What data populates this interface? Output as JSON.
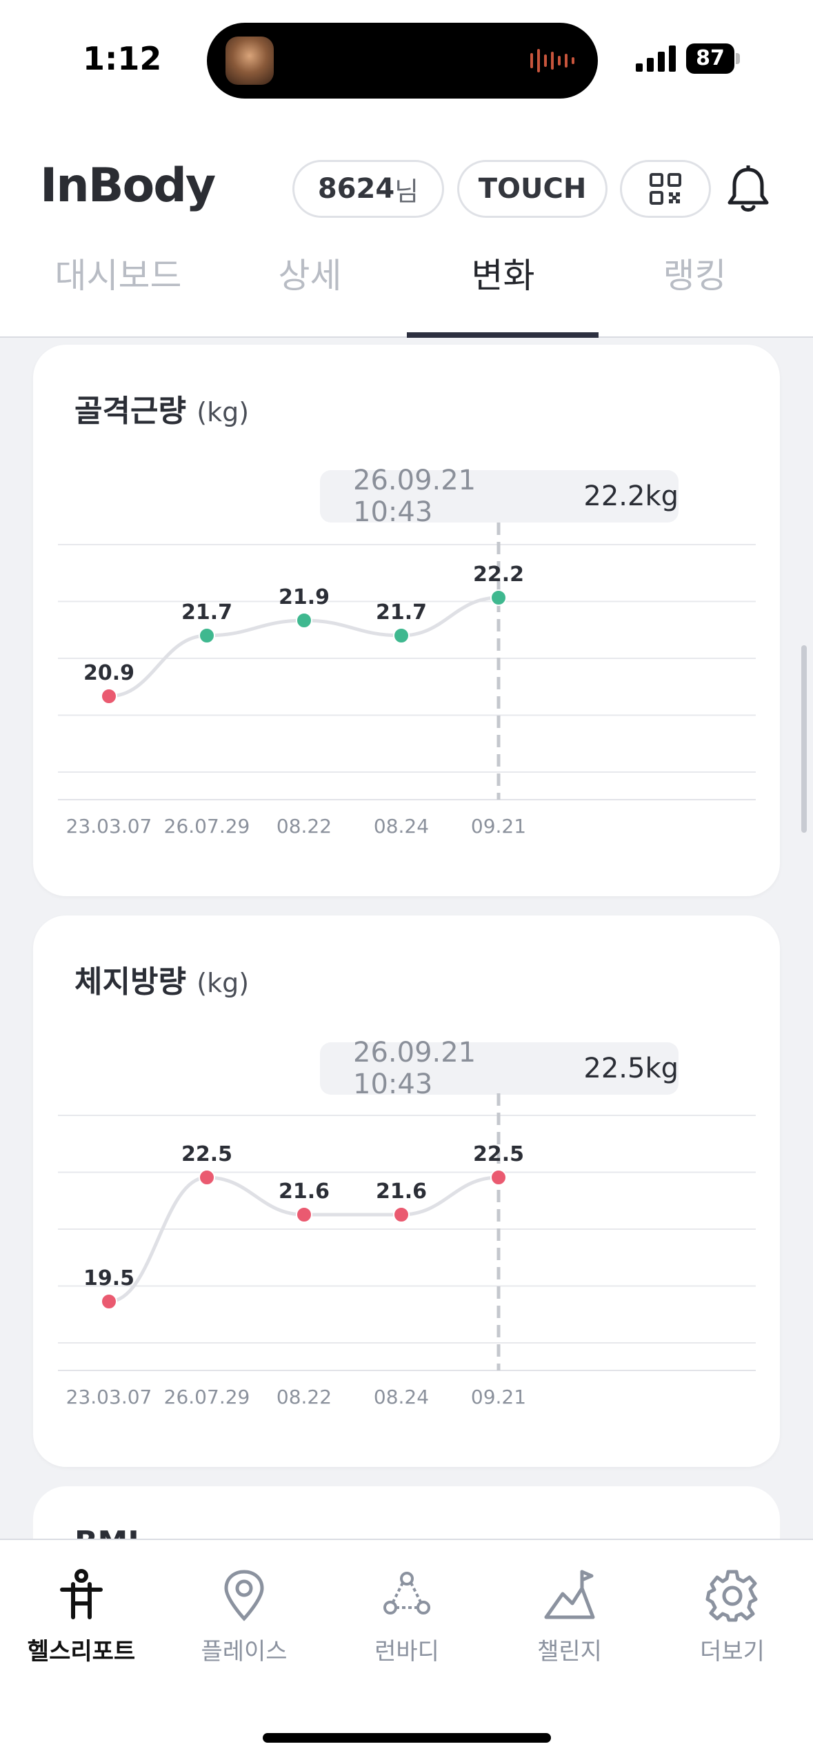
{
  "status_bar": {
    "time": "1:12",
    "battery": "87"
  },
  "header": {
    "logo": "InBody",
    "user_id": "8624",
    "user_suffix": "님",
    "touch_label": "TOUCH"
  },
  "tabs": [
    {
      "label": "대시보드"
    },
    {
      "label": "상세"
    },
    {
      "label": "변화"
    },
    {
      "label": "랭킹"
    }
  ],
  "chart_data": [
    {
      "type": "line",
      "title": "골격근량",
      "unit": "(kg)",
      "tooltip_date": "26.09.21 10:43",
      "tooltip_value": "22.2kg",
      "categories": [
        "23.03.07",
        "26.07.29",
        "08.22",
        "08.24",
        "09.21"
      ],
      "values": [
        20.9,
        21.7,
        21.9,
        21.7,
        22.2
      ],
      "point_colors": [
        "#ea5a70",
        "#3fb88f",
        "#3fb88f",
        "#3fb88f",
        "#3fb88f"
      ],
      "ylim": [
        19.9,
        22.9
      ]
    },
    {
      "type": "line",
      "title": "체지방량",
      "unit": "(kg)",
      "tooltip_date": "26.09.21 10:43",
      "tooltip_value": "22.5kg",
      "categories": [
        "23.03.07",
        "26.07.29",
        "08.22",
        "08.24",
        "09.21"
      ],
      "values": [
        19.5,
        22.5,
        21.6,
        21.6,
        22.5
      ],
      "point_colors": [
        "#ea5a70",
        "#ea5a70",
        "#ea5a70",
        "#ea5a70",
        "#ea5a70"
      ],
      "ylim": [
        18.5,
        24.0
      ]
    }
  ],
  "next_card": {
    "title": "BMI"
  },
  "bottom_nav": [
    {
      "label": "헬스리포트",
      "icon": "health-report-icon"
    },
    {
      "label": "플레이스",
      "icon": "place-pin-icon"
    },
    {
      "label": "런바디",
      "icon": "runbody-icon"
    },
    {
      "label": "챌린지",
      "icon": "challenge-flag-icon"
    },
    {
      "label": "더보기",
      "icon": "gear-icon"
    }
  ],
  "colors": {
    "accent": "#2d3040",
    "green": "#3fb88f",
    "red": "#ea5a70"
  }
}
